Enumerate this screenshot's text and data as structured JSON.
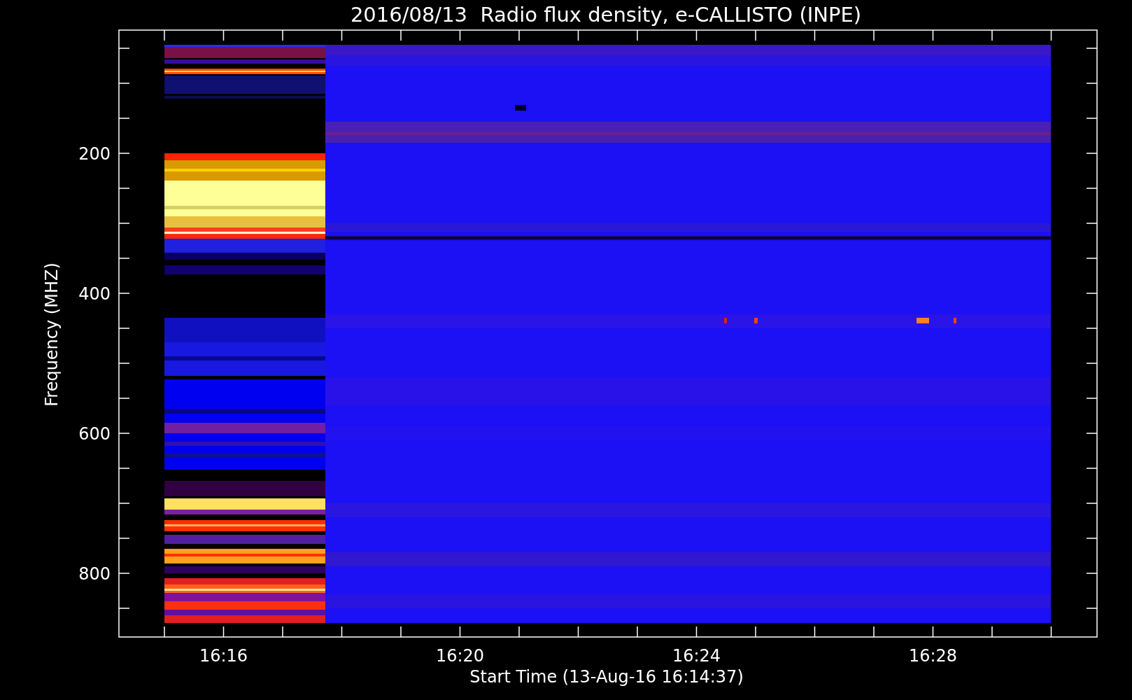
{
  "title": "2016/08/13  Radio flux density, e-CALLISTO (INPE)",
  "y_axis": {
    "label": "Frequency (MHZ)",
    "ticks": [
      "200",
      "400",
      "600",
      "800"
    ]
  },
  "x_axis": {
    "label": "Start Time (13-Aug-16 16:14:37)",
    "ticks": [
      "16:16",
      "16:20",
      "16:24",
      "16:28"
    ]
  }
}
